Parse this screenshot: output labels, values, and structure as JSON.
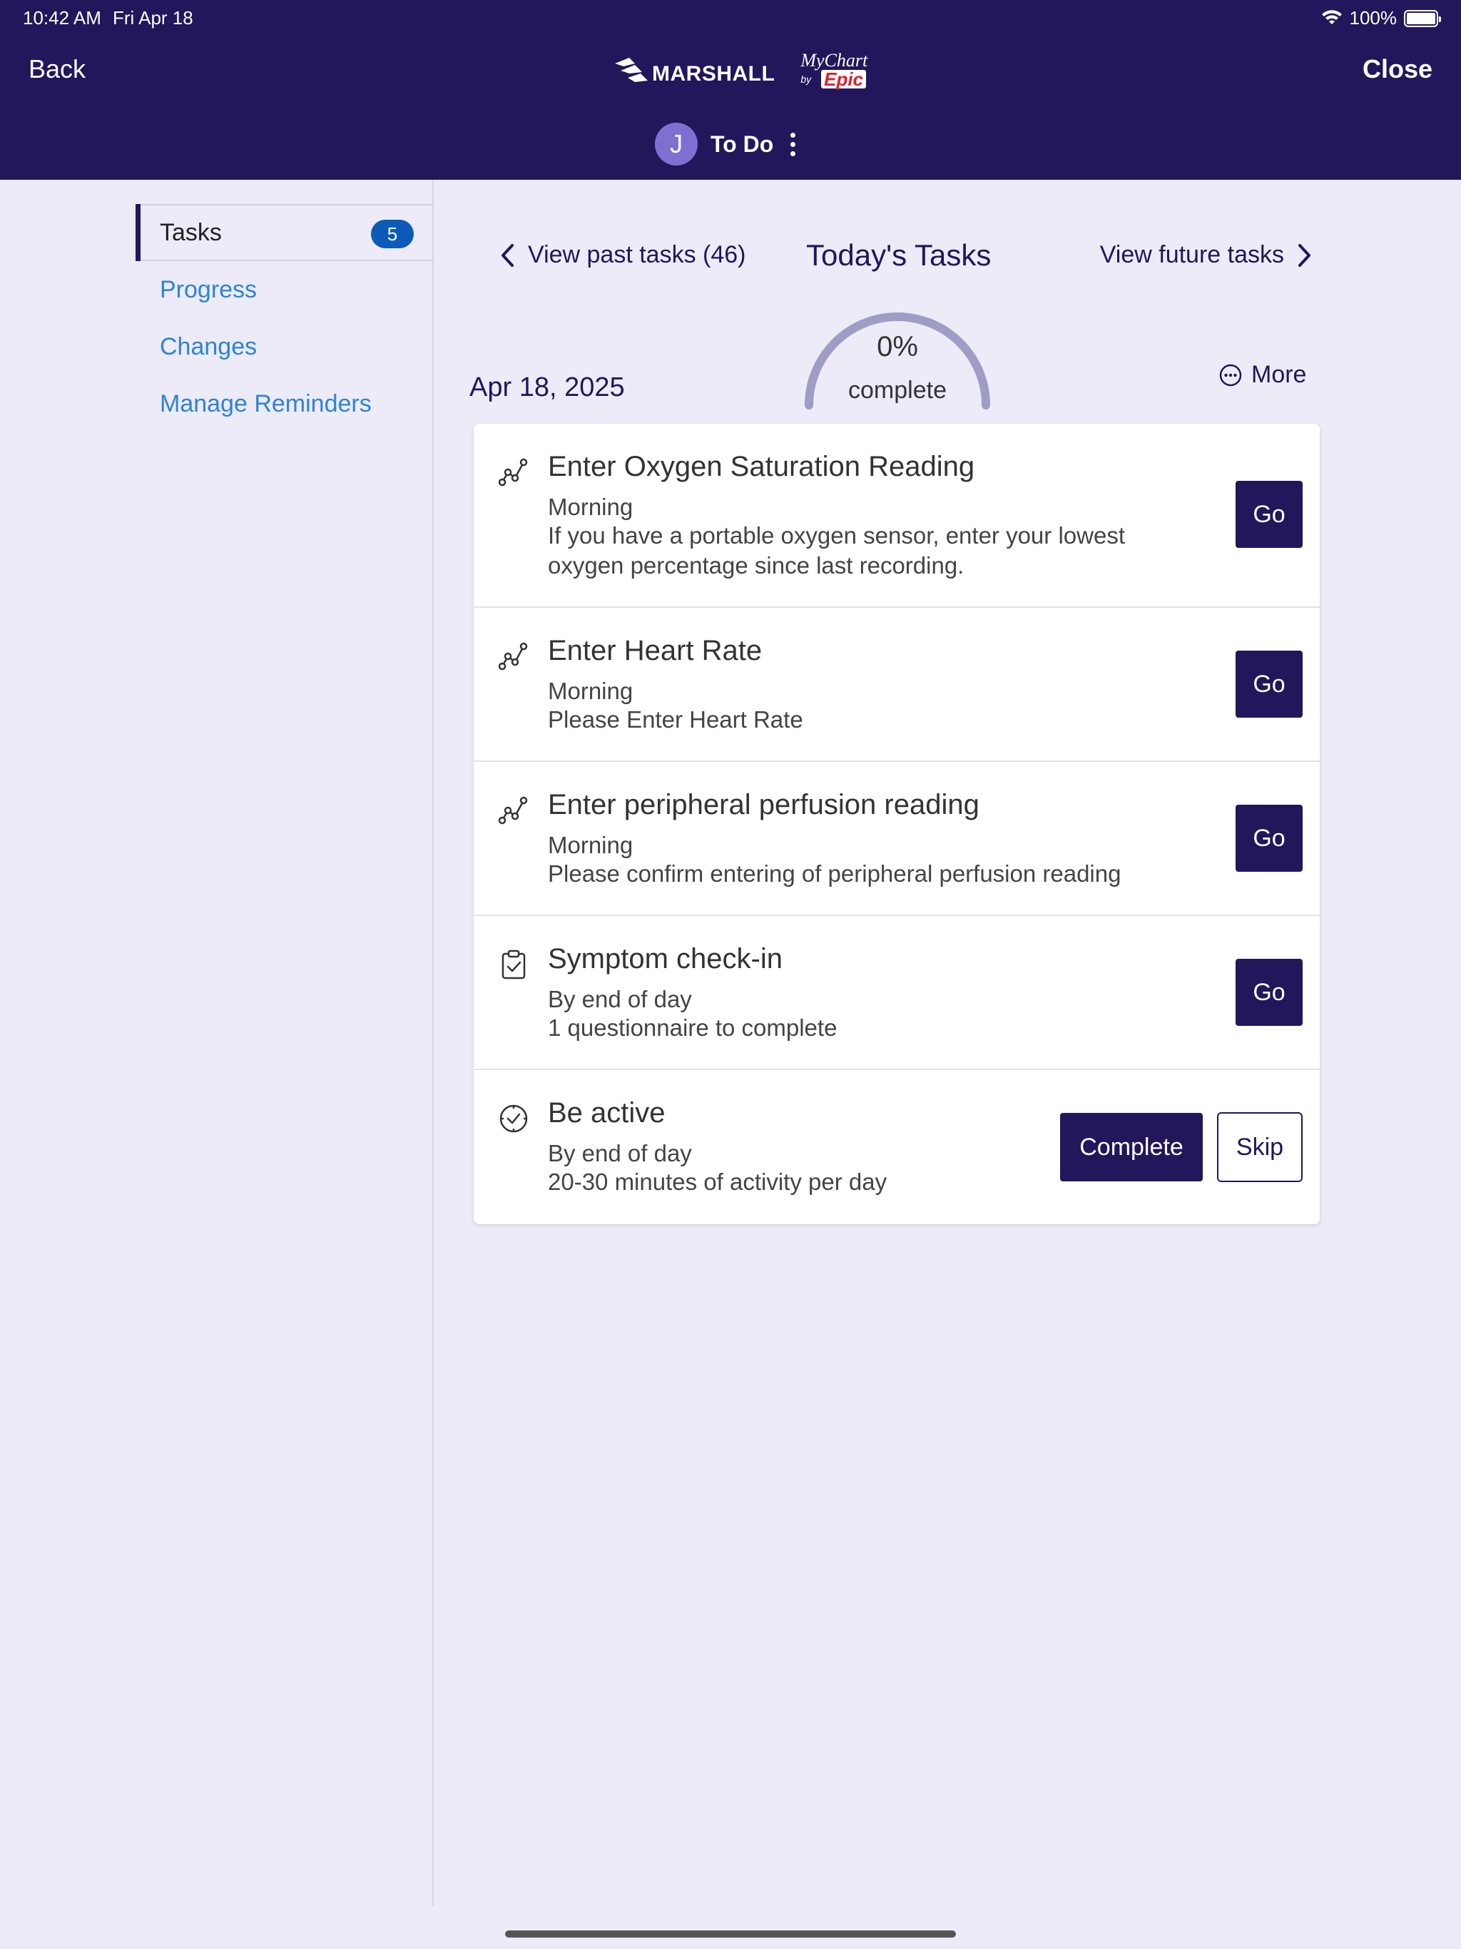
{
  "status": {
    "time": "10:42 AM",
    "date": "Fri Apr 18",
    "battery": "100%"
  },
  "nav": {
    "back": "Back",
    "close": "Close"
  },
  "logo": {
    "marshall": "MARSHALL",
    "mychart": "MyChart",
    "by": "by",
    "epic": "Epic"
  },
  "header": {
    "avatar_initial": "J",
    "title": "To Do"
  },
  "sidebar": {
    "items": [
      {
        "label": "Tasks",
        "badge": "5"
      },
      {
        "label": "Progress"
      },
      {
        "label": "Changes"
      },
      {
        "label": "Manage Reminders"
      }
    ]
  },
  "task_nav": {
    "past": "View past tasks (46)",
    "today": "Today's Tasks",
    "future": "View future tasks"
  },
  "date": "Apr 18, 2025",
  "progress": {
    "percent_label": "0%",
    "sub": "complete",
    "value": 0
  },
  "more": "More",
  "tasks": [
    {
      "icon": "chart-line-icon",
      "title": "Enter Oxygen Saturation Reading",
      "when": "Morning",
      "desc_line1": "If you have a portable oxygen sensor, enter your lowest",
      "desc_line2": "oxygen percentage since last recording.",
      "action": "Go"
    },
    {
      "icon": "chart-line-icon",
      "title": "Enter Heart Rate",
      "when": "Morning",
      "desc_line1": "Please Enter Heart Rate",
      "action": "Go"
    },
    {
      "icon": "chart-line-icon",
      "title": "Enter peripheral perfusion reading",
      "when": "Morning",
      "desc_line1": "Please confirm entering of peripheral perfusion reading",
      "action": "Go"
    },
    {
      "icon": "clipboard-check-icon",
      "title": "Symptom check-in",
      "when": "By end of day",
      "desc_line1": "1 questionnaire to complete",
      "action": "Go"
    },
    {
      "icon": "stopwatch-icon",
      "title": "Be active",
      "when": "By end of day",
      "desc_line1": "20-30 minutes of activity per day",
      "complete": "Complete",
      "skip": "Skip"
    }
  ]
}
